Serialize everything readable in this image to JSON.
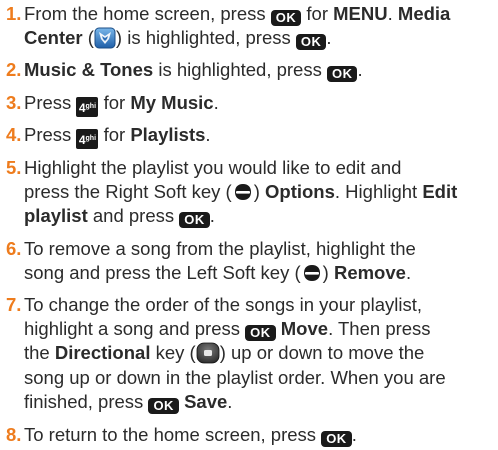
{
  "keys": {
    "ok": "OK",
    "four": "4",
    "four_sup": "ghi"
  },
  "steps": [
    {
      "number": "1.",
      "l1a": "From the home screen, press",
      "l1b": "for",
      "l1c": "MENU",
      "l1d": ".",
      "l1e": "Media",
      "l2a": "Center",
      "l2b": "(",
      "l2c": ") is highlighted, press",
      "l2d": "."
    },
    {
      "number": "2.",
      "a": "Music & Tones",
      "b": "is highlighted, press",
      "c": "."
    },
    {
      "number": "3.",
      "a": "Press",
      "b": "for",
      "c": "My Music",
      "d": "."
    },
    {
      "number": "4.",
      "a": "Press",
      "b": "for",
      "c": "Playlists",
      "d": "."
    },
    {
      "number": "5.",
      "l1": "Highlight the playlist you would like to edit and",
      "l2a": "press the Right Soft key (",
      "l2b": ")",
      "l2c": "Options",
      "l2d": ". Highlight",
      "l2e": "Edit",
      "l3a": "playlist",
      "l3b": "and press",
      "l3c": "."
    },
    {
      "number": "6.",
      "l1": "To remove a song from the playlist, highlight the",
      "l2a": "song and press the Left Soft key (",
      "l2b": ")",
      "l2c": "Remove",
      "l2d": "."
    },
    {
      "number": "7.",
      "l1": "To change the order of the songs in your playlist,",
      "l2a": "highlight a song and press",
      "l2b": "Move",
      "l2c": ". Then press",
      "l3a": "the",
      "l3b": "Directional",
      "l3c": "key (",
      "l3d": ") up or down to move the",
      "l4": "song up or down in the playlist order. When you are",
      "l5a": "finished, press",
      "l5b": "Save",
      "l5c": "."
    },
    {
      "number": "8.",
      "a": "To return to the home screen, press",
      "b": "."
    }
  ]
}
